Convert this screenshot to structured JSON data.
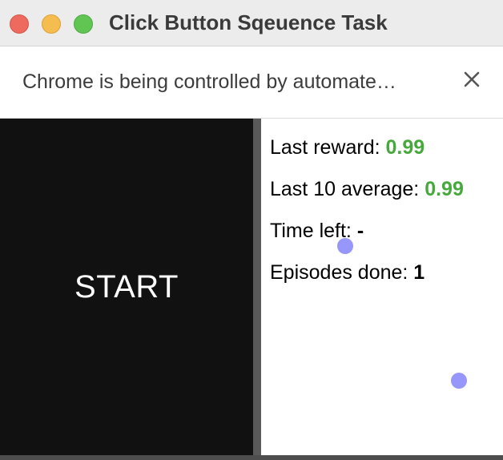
{
  "window": {
    "title": "Click Button Sqeuence Task"
  },
  "infobar": {
    "message": "Chrome is being controlled by automate…",
    "close_icon": "close-icon"
  },
  "task": {
    "start_label": "START"
  },
  "stats": {
    "last_reward_label": "Last reward: ",
    "last_reward_value": "0.99",
    "last10_label": "Last 10 average: ",
    "last10_value": "0.99",
    "time_left_label": "Time left: ",
    "time_left_value": "-",
    "episodes_label": "Episodes done: ",
    "episodes_value": "1"
  },
  "colors": {
    "reward_green": "#46a93c",
    "task_bg": "#111111",
    "cursor_dot": "#6e6efa"
  }
}
